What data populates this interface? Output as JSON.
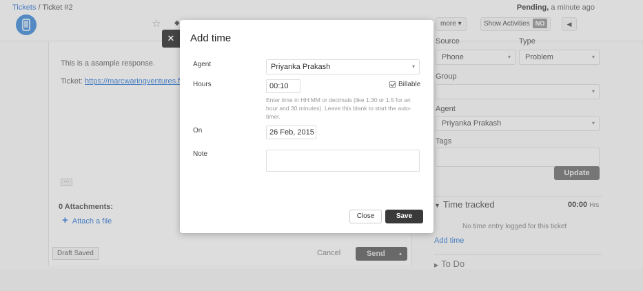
{
  "breadcrumb": {
    "root": "Tickets",
    "separator": " / ",
    "current": "Ticket #2"
  },
  "status": {
    "state": "Pending,",
    "time": "a minute ago"
  },
  "toolbar": {
    "more_label": "more",
    "show_activities_label": "Show Activities",
    "show_activities_toggle": "NO",
    "caret": "▾",
    "left_arrow": "◀"
  },
  "compose": {
    "response_text": "This is a asample response.",
    "ticket_prefix": "Ticket: ",
    "ticket_link": "https://marcwaringventures.fres",
    "ellipsis": "···",
    "attachments_label": "0 Attachments:",
    "attach_plus": "+",
    "attach_file_label": "Attach a file",
    "draft_saved_label": "Draft Saved",
    "cancel_label": "Cancel",
    "send_label": "Send",
    "send_caret": "▴"
  },
  "sidebar": {
    "source_label": "Source",
    "source_value": "Phone",
    "type_label": "Type",
    "type_value": "Problem",
    "group_label": "Group",
    "group_value": "",
    "agent_label": "Agent",
    "agent_value": "Priyanka Prakash",
    "tags_label": "Tags",
    "update_label": "Update",
    "chevron": "▾",
    "time_tracked_label": "Time tracked",
    "time_tracked_triangle": "▼",
    "time_value": "00:00",
    "time_unit": "Hrs",
    "no_time_text": "No time entry logged for this ticket",
    "add_time_label": "Add time",
    "todo_label": "To Do",
    "todo_triangle": "▶"
  },
  "modal": {
    "close_x": "✕",
    "title": "Add time",
    "agent_label": "Agent",
    "agent_value": "Priyanka Prakash",
    "agent_chevron": "▾",
    "hours_label": "Hours",
    "hours_value": "00:10",
    "billable_label": "Billable",
    "help_text": "Enter time in HH:MM or decimals (like 1:30 or 1.5 for an hour and 30 minutes). Leave this blank to start the auto-timer.",
    "on_label": "On",
    "on_value": "26 Feb, 2015",
    "note_label": "Note",
    "note_value": "",
    "close_label": "Close",
    "save_label": "Save"
  },
  "icons": {
    "device": "mobile-phone-icon",
    "star": "star-icon",
    "wrench": "wrench-icon"
  },
  "colors": {
    "link": "#3a7fd5",
    "primary_button": "#3a3a3a",
    "device_badge": "#4a90d9"
  }
}
